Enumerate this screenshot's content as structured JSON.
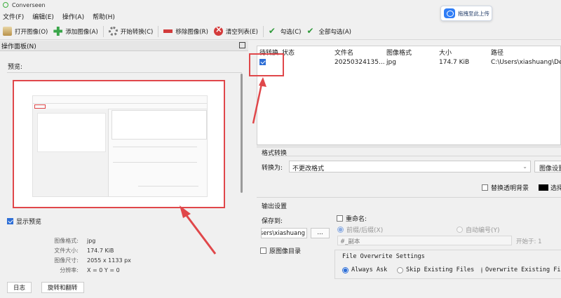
{
  "window": {
    "title": "Converseen"
  },
  "overlay": {
    "upload_button": "拖拽至此上传"
  },
  "menu": [
    "文件(F)",
    "编辑(E)",
    "操作(A)",
    "帮助(H)"
  ],
  "toolbar": {
    "open": "打开图像(O)",
    "add": "添加图像(A)",
    "convert": "开始转换(C)",
    "remove": "移除图像(R)",
    "clear": "清空列表(E)",
    "check": "勾选(C)",
    "check_all": "全部勾选(A)"
  },
  "panel": {
    "title": "操作面板(N)",
    "preview_label": "预览:",
    "show_preview": "显示预览",
    "info": [
      {
        "k": "图像格式:",
        "v": "jpg"
      },
      {
        "k": "文件大小:",
        "v": "174.7 KiB"
      },
      {
        "k": "图像尺寸:",
        "v": "2055 x 1133 px"
      },
      {
        "k": "分辨率:",
        "v": "X = 0 Y = 0"
      }
    ],
    "bottom_tabs": [
      "日志",
      "旋转和翻转"
    ]
  },
  "table": {
    "headers": [
      "待转换",
      "状态",
      "文件名",
      "图像格式",
      "大小",
      "路径"
    ],
    "rows": [
      {
        "checked": true,
        "status": "",
        "filename": "20250324135...",
        "format": "jpg",
        "size": "174.7 KiB",
        "path": "C:\\Users\\xiashuang\\Des"
      }
    ]
  },
  "convert": {
    "section_title": "格式转换",
    "convert_to_label": "转换为:",
    "convert_to_value": "不更改格式",
    "image_settings": "图像设置",
    "replace_transparent": "替换透明背景",
    "choose_color": "选择颜色"
  },
  "output": {
    "section_title": "输出设置",
    "save_to_label": "保存到:",
    "save_path": "C:\\Users\\xiashuang",
    "browse": "...",
    "original_dir": "原图像目录",
    "rename": "重命名:",
    "prefix_suffix": "前缀/后缀(X)",
    "auto_number": "自动编号(Y)",
    "rename_pattern": "#_副本",
    "start_at": "开始于:  1",
    "overwrite_title": "File Overwrite Settings",
    "overwrite_options": [
      "Always Ask",
      "Skip Existing Files",
      "Overwrite Existing Files"
    ]
  },
  "colors": {
    "highlight": "#e0474a",
    "accent": "#2f6fd6"
  }
}
